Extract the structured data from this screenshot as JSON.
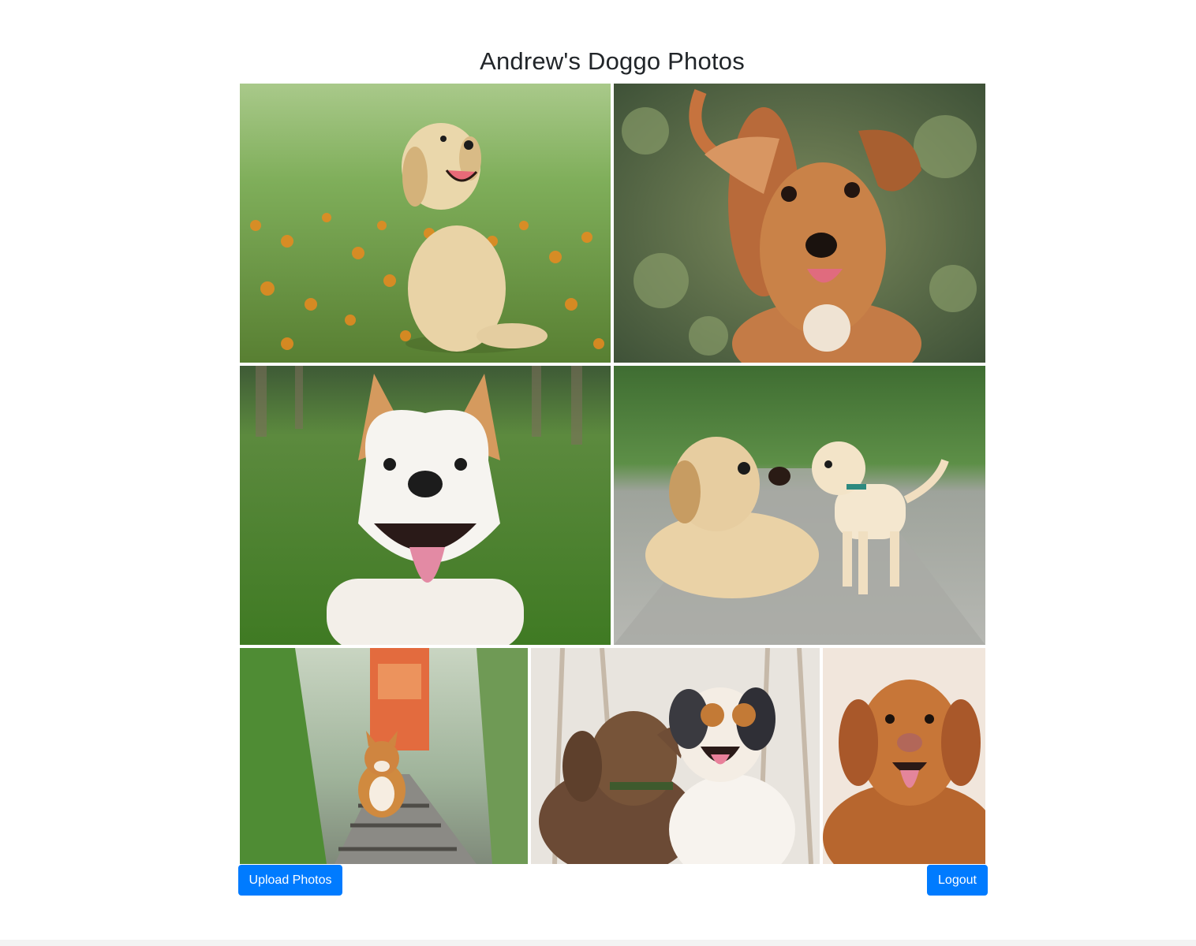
{
  "header": {
    "title": "Andrew's Doggo Photos"
  },
  "gallery": {
    "photos": [
      {
        "subject": "golden retriever puppy in flower field",
        "icon": "photo"
      },
      {
        "subject": "tan dog with floppy ear in garden",
        "icon": "photo"
      },
      {
        "subject": "smiling white dog on grass",
        "icon": "photo"
      },
      {
        "subject": "labrador and puppy on path",
        "icon": "photo"
      },
      {
        "subject": "corgi running on railway track",
        "icon": "photo"
      },
      {
        "subject": "two dogs nuzzling",
        "icon": "photo"
      },
      {
        "subject": "red retriever puppy portrait",
        "icon": "photo"
      }
    ]
  },
  "actions": {
    "upload_label": "Upload Photos",
    "logout_label": "Logout"
  },
  "colors": {
    "primary": "#007bff",
    "text": "#212529",
    "background": "#ffffff"
  }
}
